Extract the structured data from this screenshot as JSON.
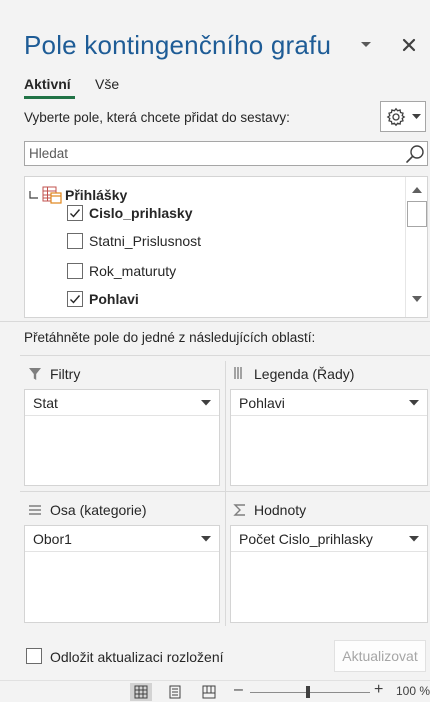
{
  "pane": {
    "title": "Pole kontingenčního grafu",
    "tabs": [
      {
        "label": "Aktivní",
        "active": true
      },
      {
        "label": "Vše",
        "active": false
      }
    ],
    "instruction": "Vyberte pole, která chcete přidat do sestavy:"
  },
  "search": {
    "placeholder": "Hledat",
    "value": ""
  },
  "field_list": {
    "table_name": "Přihlášky",
    "fields": [
      {
        "label": "Cislo_prihlasky",
        "checked": true
      },
      {
        "label": "Statni_Prislusnost",
        "checked": false
      },
      {
        "label": "Rok_maturuty",
        "checked": false
      },
      {
        "label": "Pohlavi",
        "checked": true
      }
    ]
  },
  "areas": {
    "drag_instruction": "Přetáhněte pole do jedné z následujících oblastí:",
    "filters": {
      "title": "Filtry",
      "icon": "filter-icon",
      "items": [
        "Stat"
      ]
    },
    "legend": {
      "title": "Legenda (Řady)",
      "icon": "columns-icon",
      "items": [
        "Pohlavi"
      ]
    },
    "axis": {
      "title": "Osa (kategorie)",
      "icon": "rows-icon",
      "items": [
        "Obor1"
      ]
    },
    "values": {
      "title": "Hodnoty",
      "icon": "sigma-icon",
      "items": [
        "Počet Cislo_prihlasky"
      ]
    }
  },
  "footer": {
    "defer_label": "Odložit aktualizaci rozložení",
    "defer_checked": false,
    "update_label": "Aktualizovat"
  },
  "status_bar": {
    "zoom_minus": "–",
    "zoom_plus": "+",
    "zoom_level": "100 %",
    "zoom_fraction": 0.48
  },
  "colors": {
    "title": "#1e5c96",
    "tab_underline": "#217346"
  }
}
